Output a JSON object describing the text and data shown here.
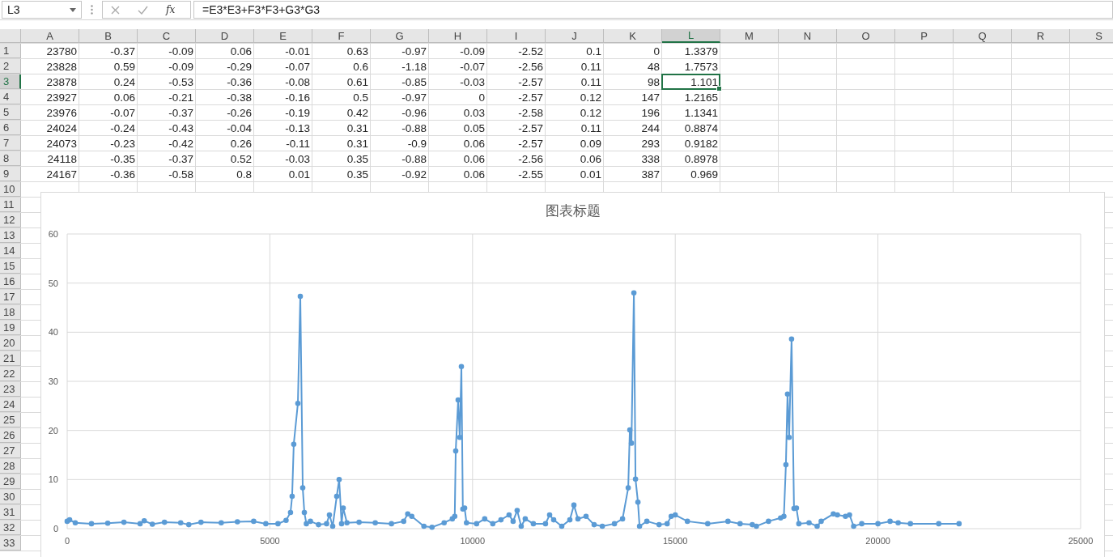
{
  "formula_bar": {
    "name_box": "L3",
    "function_label": "fx",
    "formula": "=E3*E3+F3*F3+G3*G3"
  },
  "columns": [
    {
      "label": "A",
      "selected": false
    },
    {
      "label": "B",
      "selected": false
    },
    {
      "label": "C",
      "selected": false
    },
    {
      "label": "D",
      "selected": false
    },
    {
      "label": "E",
      "selected": false
    },
    {
      "label": "F",
      "selected": false
    },
    {
      "label": "G",
      "selected": false
    },
    {
      "label": "H",
      "selected": false
    },
    {
      "label": "I",
      "selected": false
    },
    {
      "label": "J",
      "selected": false
    },
    {
      "label": "K",
      "selected": false
    },
    {
      "label": "L",
      "selected": true
    },
    {
      "label": "M",
      "selected": false
    },
    {
      "label": "N",
      "selected": false
    },
    {
      "label": "O",
      "selected": false
    },
    {
      "label": "P",
      "selected": false
    },
    {
      "label": "Q",
      "selected": false
    },
    {
      "label": "R",
      "selected": false
    },
    {
      "label": "S",
      "selected": false
    }
  ],
  "rows": [
    {
      "header": "1",
      "selected": false,
      "cells": [
        "23780",
        "-0.37",
        "-0.09",
        "0.06",
        "-0.01",
        "0.63",
        "-0.97",
        "-0.09",
        "-2.52",
        "0.1",
        "0",
        "1.3379"
      ]
    },
    {
      "header": "2",
      "selected": false,
      "cells": [
        "23828",
        "0.59",
        "-0.09",
        "-0.29",
        "-0.07",
        "0.6",
        "-1.18",
        "-0.07",
        "-2.56",
        "0.11",
        "48",
        "1.7573"
      ]
    },
    {
      "header": "3",
      "selected": true,
      "cells": [
        "23878",
        "0.24",
        "-0.53",
        "-0.36",
        "-0.08",
        "0.61",
        "-0.85",
        "-0.03",
        "-2.57",
        "0.11",
        "98",
        "1.101"
      ]
    },
    {
      "header": "4",
      "selected": false,
      "cells": [
        "23927",
        "0.06",
        "-0.21",
        "-0.38",
        "-0.16",
        "0.5",
        "-0.97",
        "0",
        "-2.57",
        "0.12",
        "147",
        "1.2165"
      ]
    },
    {
      "header": "5",
      "selected": false,
      "cells": [
        "23976",
        "-0.07",
        "-0.37",
        "-0.26",
        "-0.19",
        "0.42",
        "-0.96",
        "0.03",
        "-2.58",
        "0.12",
        "196",
        "1.1341"
      ]
    },
    {
      "header": "6",
      "selected": false,
      "cells": [
        "24024",
        "-0.24",
        "-0.43",
        "-0.04",
        "-0.13",
        "0.31",
        "-0.88",
        "0.05",
        "-2.57",
        "0.11",
        "244",
        "0.8874"
      ]
    },
    {
      "header": "7",
      "selected": false,
      "cells": [
        "24073",
        "-0.23",
        "-0.42",
        "0.26",
        "-0.11",
        "0.31",
        "-0.9",
        "0.06",
        "-2.57",
        "0.09",
        "293",
        "0.9182"
      ]
    },
    {
      "header": "8",
      "selected": false,
      "cells": [
        "24118",
        "-0.35",
        "-0.37",
        "0.52",
        "-0.03",
        "0.35",
        "-0.88",
        "0.06",
        "-2.56",
        "0.06",
        "338",
        "0.8978"
      ]
    },
    {
      "header": "9",
      "selected": false,
      "cells": [
        "24167",
        "-0.36",
        "-0.58",
        "0.8",
        "0.01",
        "0.35",
        "-0.92",
        "0.06",
        "-2.55",
        "0.01",
        "387",
        "0.969"
      ]
    },
    {
      "header": "10",
      "selected": false
    },
    {
      "header": "11",
      "selected": false
    },
    {
      "header": "12",
      "selected": false
    },
    {
      "header": "13",
      "selected": false
    },
    {
      "header": "14",
      "selected": false
    },
    {
      "header": "15",
      "selected": false
    },
    {
      "header": "16",
      "selected": false
    },
    {
      "header": "17",
      "selected": false
    },
    {
      "header": "18",
      "selected": false
    },
    {
      "header": "19",
      "selected": false
    },
    {
      "header": "20",
      "selected": false
    },
    {
      "header": "21",
      "selected": false
    },
    {
      "header": "22",
      "selected": false
    },
    {
      "header": "23",
      "selected": false
    },
    {
      "header": "24",
      "selected": false
    },
    {
      "header": "25",
      "selected": false
    },
    {
      "header": "26",
      "selected": false
    },
    {
      "header": "27",
      "selected": false
    },
    {
      "header": "28",
      "selected": false
    },
    {
      "header": "29",
      "selected": false
    },
    {
      "header": "30",
      "selected": false
    },
    {
      "header": "31",
      "selected": false
    },
    {
      "header": "32",
      "selected": false
    },
    {
      "header": "33",
      "selected": false
    }
  ],
  "chart": {
    "chart_data": {
      "type": "line",
      "grid": true,
      "title": "图表标题",
      "xlim": [
        0,
        25000
      ],
      "ylim": [
        0,
        60
      ],
      "xticks": [
        0,
        5000,
        10000,
        15000,
        20000,
        25000
      ],
      "yticks": [
        0,
        10,
        20,
        30,
        40,
        50,
        60
      ],
      "x": [
        0,
        60,
        200,
        600,
        1000,
        1400,
        1800,
        1900,
        2100,
        2400,
        2800,
        3000,
        3300,
        3800,
        4200,
        4600,
        4900,
        5200,
        5400,
        5510,
        5550,
        5590,
        5690,
        5750,
        5810,
        5850,
        5900,
        6000,
        6200,
        6400,
        6470,
        6550,
        6650,
        6710,
        6770,
        6810,
        6900,
        7200,
        7600,
        8000,
        8300,
        8400,
        8500,
        8800,
        9000,
        9300,
        9500,
        9560,
        9585,
        9645,
        9685,
        9725,
        9760,
        9805,
        9850,
        10100,
        10300,
        10500,
        10700,
        10900,
        11000,
        11100,
        11200,
        11300,
        11500,
        11800,
        11900,
        12000,
        12200,
        12400,
        12500,
        12600,
        12800,
        13000,
        13200,
        13500,
        13700,
        13840,
        13880,
        13920,
        13980,
        14020,
        14080,
        14120,
        14300,
        14600,
        14800,
        14900,
        15000,
        15300,
        15800,
        16300,
        16600,
        16900,
        17000,
        17300,
        17600,
        17680,
        17730,
        17770,
        17810,
        17870,
        17930,
        17990,
        18050,
        18300,
        18500,
        18600,
        18900,
        19000,
        19200,
        19300,
        19400,
        19600,
        20000,
        20300,
        20500,
        20800,
        21500,
        22000
      ],
      "series": [
        {
          "color": "#5b9bd5",
          "marker": true,
          "values": [
            1.5,
            1.8,
            1.2,
            1.0,
            1.1,
            1.3,
            1.0,
            1.6,
            0.9,
            1.3,
            1.2,
            0.8,
            1.3,
            1.2,
            1.4,
            1.5,
            1.0,
            1.0,
            1.7,
            3.3,
            6.6,
            17.2,
            25.5,
            47.3,
            8.3,
            3.3,
            1.0,
            1.5,
            0.8,
            1.0,
            2.8,
            0.5,
            6.6,
            10,
            1.0,
            4.2,
            1.2,
            1.3,
            1.2,
            1.0,
            1.5,
            3.0,
            2.5,
            0.5,
            0.3,
            1.2,
            2.0,
            2.5,
            15.8,
            26.2,
            18.6,
            33,
            4,
            4.2,
            1.2,
            1.0,
            2.0,
            1.0,
            1.8,
            2.8,
            1.5,
            3.7,
            0.5,
            2.0,
            1.0,
            1.0,
            2.8,
            1.8,
            0.5,
            1.8,
            4.8,
            2.0,
            2.5,
            0.8,
            0.5,
            1.0,
            2.0,
            8.3,
            20.1,
            17.4,
            48,
            10.1,
            5.4,
            0.5,
            1.5,
            0.8,
            1.0,
            2.5,
            2.8,
            1.5,
            1.0,
            1.5,
            1.0,
            0.8,
            0.5,
            1.5,
            2.2,
            2.5,
            13,
            27.4,
            18.6,
            38.6,
            4.1,
            4.2,
            1.0,
            1.2,
            0.5,
            1.5,
            3.0,
            2.8,
            2.5,
            2.8,
            0.5,
            1.0,
            1.0,
            1.5,
            1.2,
            1.0,
            1.0,
            1.0
          ]
        }
      ]
    }
  }
}
